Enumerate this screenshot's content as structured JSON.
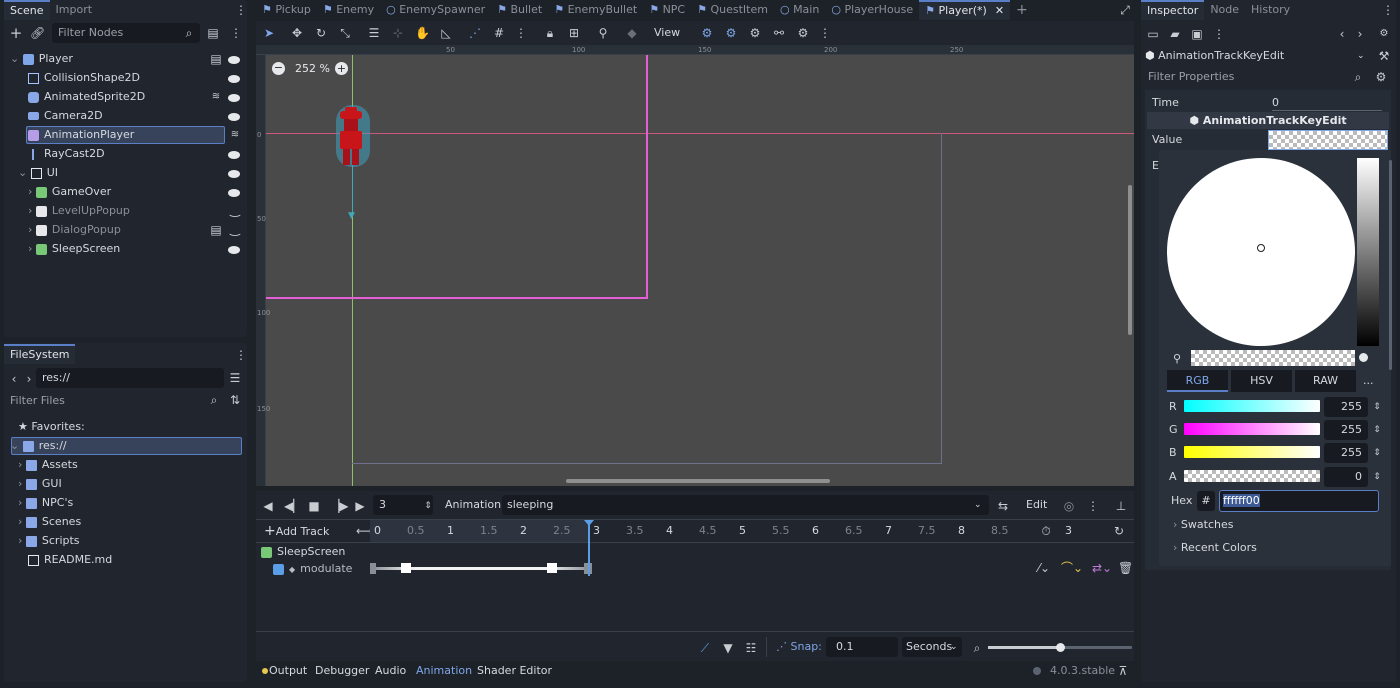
{
  "scene_dock": {
    "tabs": [
      "Scene",
      "Import"
    ],
    "filter_placeholder": "Filter Nodes",
    "tree": [
      {
        "label": "Player",
        "icon": "player-node-icon"
      },
      {
        "label": "CollisionShape2D",
        "icon": "collision-shape-icon"
      },
      {
        "label": "AnimatedSprite2D",
        "icon": "animated-sprite-icon"
      },
      {
        "label": "Camera2D",
        "icon": "camera-icon"
      },
      {
        "label": "AnimationPlayer",
        "icon": "animation-player-icon"
      },
      {
        "label": "RayCast2D",
        "icon": "raycast-icon"
      },
      {
        "label": "UI",
        "icon": "control-node-icon"
      },
      {
        "label": "GameOver",
        "icon": "scene-instance-icon"
      },
      {
        "label": "LevelUpPopup",
        "icon": "popup-icon"
      },
      {
        "label": "DialogPopup",
        "icon": "popup-icon"
      },
      {
        "label": "SleepScreen",
        "icon": "scene-instance-icon"
      }
    ]
  },
  "filesystem_dock": {
    "tab": "FileSystem",
    "path": "res://",
    "filter_placeholder": "Filter Files",
    "favorites_label": "Favorites:",
    "items": [
      "res://",
      "Assets",
      "GUI",
      "NPC's",
      "Scenes",
      "Scripts",
      "README.md"
    ]
  },
  "editor_tabs": [
    "Pickup",
    "Enemy",
    "EnemySpawner",
    "Bullet",
    "EnemyBullet",
    "NPC",
    "QuestItem",
    "Main",
    "PlayerHouse",
    "Player(*)"
  ],
  "toolbar": {
    "view_label": "View",
    "zoom": "252 %"
  },
  "viewport": {
    "ruler_top": [
      "50",
      "100",
      "150",
      "200",
      "250"
    ],
    "ruler_left": [
      "0",
      "50",
      "100",
      "150"
    ]
  },
  "animation": {
    "current_time": "3",
    "animation_label": "Animation",
    "animation_name": "sleeping",
    "edit_label": "Edit",
    "add_track_label": "Add Track",
    "timeline": [
      "0",
      "0.5",
      "1",
      "1.5",
      "2",
      "2.5",
      "3",
      "3.5",
      "4",
      "4.5",
      "5",
      "5.5",
      "6",
      "6.5",
      "7",
      "7.5",
      "8",
      "8.5"
    ],
    "length": "3",
    "track_node": "SleepScreen",
    "track_property": "modulate",
    "snap_label": "Snap:",
    "snap_value": "0.1",
    "snap_unit": "Seconds"
  },
  "bottom_panel": {
    "tabs": [
      "Output",
      "Debugger",
      "Audio",
      "Animation",
      "Shader Editor"
    ],
    "version": "4.0.3.stable"
  },
  "inspector": {
    "tabs": [
      "Inspector",
      "Node",
      "History"
    ],
    "object_name": "AnimationTrackKeyEdit",
    "filter_placeholder": "Filter Properties",
    "time_label": "Time",
    "time_value": "0",
    "section_title": "AnimationTrackKeyEdit",
    "value_label": "Value",
    "easing_initial": "E",
    "color_modes": [
      "RGB",
      "HSV",
      "RAW"
    ],
    "more_label": "...",
    "channels": [
      {
        "label": "R",
        "value": "255"
      },
      {
        "label": "G",
        "value": "255"
      },
      {
        "label": "B",
        "value": "255"
      },
      {
        "label": "A",
        "value": "0"
      }
    ],
    "hex_label": "Hex",
    "hex_hash": "#",
    "hex_value": "ffffff00",
    "swatches_label": "Swatches",
    "recent_label": "Recent Colors"
  },
  "colors": {
    "accent": "#5b7fc7",
    "bg": "#1d2229",
    "panel": "#21262e",
    "viewport": "#4a4a4a",
    "frame_pink": "#e25fd8"
  }
}
